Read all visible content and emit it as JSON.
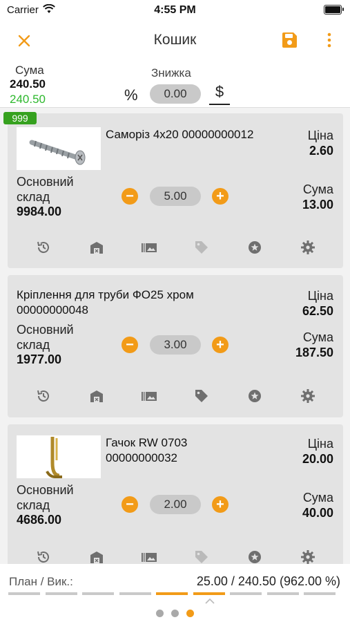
{
  "status": {
    "carrier": "Carrier",
    "time": "4:55 PM"
  },
  "topbar": {
    "title": "Кошик"
  },
  "summary": {
    "sum_label": "Сума",
    "sum_value": "240.50",
    "sum_value_discounted": "240.50",
    "discount_label": "Знижка",
    "percent_symbol": "%",
    "discount_value": "0.00",
    "dollar_symbol": "$"
  },
  "badge": "999",
  "cards": [
    {
      "name_line1": "Саморіз 4x20 00000000012",
      "name_line2": "",
      "price_label": "Ціна",
      "price": "2.60",
      "warehouse_line1": "Основний",
      "warehouse_line2": "склад",
      "stock": "9984.00",
      "qty": "5.00",
      "sum_label": "Сума",
      "sum": "13.00",
      "has_image": true,
      "icons": [
        "history-icon",
        "warehouse-icon",
        "barcode-gallery-icon",
        "tag-icon",
        "star-icon",
        "gear-icon"
      ]
    },
    {
      "name_line1": "Кріплення для труби ФО25 хром",
      "name_line2": "00000000048",
      "price_label": "Ціна",
      "price": "62.50",
      "warehouse_line1": "Основний",
      "warehouse_line2": "склад",
      "stock": "1977.00",
      "qty": "3.00",
      "sum_label": "Сума",
      "sum": "187.50",
      "has_image": false,
      "icons": [
        "history-icon",
        "warehouse-icon",
        "barcode-gallery-icon",
        "tag-icon",
        "star-icon",
        "gear-icon"
      ]
    },
    {
      "name_line1": "Гачок RW 0703",
      "name_line2": "00000000032",
      "price_label": "Ціна",
      "price": "20.00",
      "warehouse_line1": "Основний",
      "warehouse_line2": "склад",
      "stock": "4686.00",
      "qty": "2.00",
      "sum_label": "Сума",
      "sum": "40.00",
      "has_image": true,
      "icons": [
        "history-icon",
        "warehouse-icon",
        "barcode-gallery-icon",
        "tag-icon",
        "star-icon",
        "gear-icon"
      ]
    }
  ],
  "footer": {
    "plan_label": "План / Вик.:",
    "plan_value": "25.00 / 240.50 (962.00 %)",
    "segments_total": 9,
    "segments_active": [
      4,
      5
    ],
    "page_dots": 3,
    "page_active": 2
  },
  "colors": {
    "accent": "#f29b18",
    "green": "#2db82d",
    "badge": "#36a11f",
    "card_bg": "#e3e3e3"
  }
}
